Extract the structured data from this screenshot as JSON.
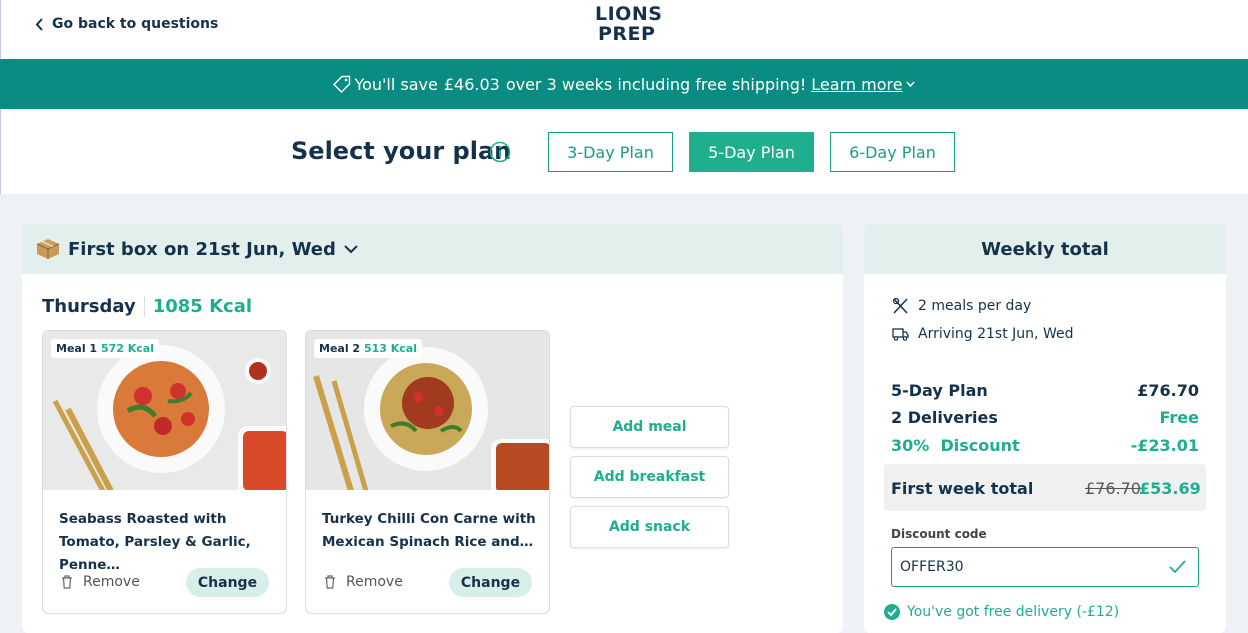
{
  "header": {
    "back_label": "Go back to questions",
    "logo_line1": "LIONS",
    "logo_line2": "PREP"
  },
  "banner": {
    "text_before": "You'll save",
    "amount": "£46.03",
    "text_after": "over 3 weeks including free shipping!",
    "learn_more": "Learn more"
  },
  "plan_selector": {
    "title": "Select your plan",
    "options": [
      "3-Day Plan",
      "5-Day Plan",
      "6-Day Plan"
    ],
    "selected": "5-Day Plan"
  },
  "box": {
    "title": "First box on 21st Jun, Wed",
    "day": "Thursday",
    "day_kcal": "1085 Kcal",
    "meals": [
      {
        "label": "Meal 1",
        "kcal": "572 Kcal",
        "name": "Seabass Roasted with Tomato, Parsley & Garlic, Penne…",
        "remove": "Remove",
        "change": "Change"
      },
      {
        "label": "Meal 2",
        "kcal": "513 Kcal",
        "name": "Turkey Chilli Con Carne with Mexican Spinach Rice and…",
        "remove": "Remove",
        "change": "Change"
      }
    ],
    "add_buttons": [
      "Add meal",
      "Add breakfast",
      "Add snack"
    ]
  },
  "weekly": {
    "title": "Weekly total",
    "meals_per_day": "2 meals per day",
    "arriving": "Arriving 21st Jun, Wed",
    "plan_label": "5-Day Plan",
    "plan_price": "£76.70",
    "deliveries_label": "2 Deliveries",
    "deliveries_price": "Free",
    "discount_label": "30%  Discount",
    "discount_value": "-£23.01",
    "total_label": "First week total",
    "total_old": "£76.70",
    "total_new": "£53.69",
    "discount_code_label": "Discount code",
    "discount_code_value": "OFFER30",
    "free_delivery_msg": "You've got free delivery (-£12)"
  },
  "colors": {
    "teal_banner": "#0b8c82",
    "green_accent": "#1fae8e",
    "navy_text": "#16324a",
    "panel_header": "#e3efec"
  }
}
